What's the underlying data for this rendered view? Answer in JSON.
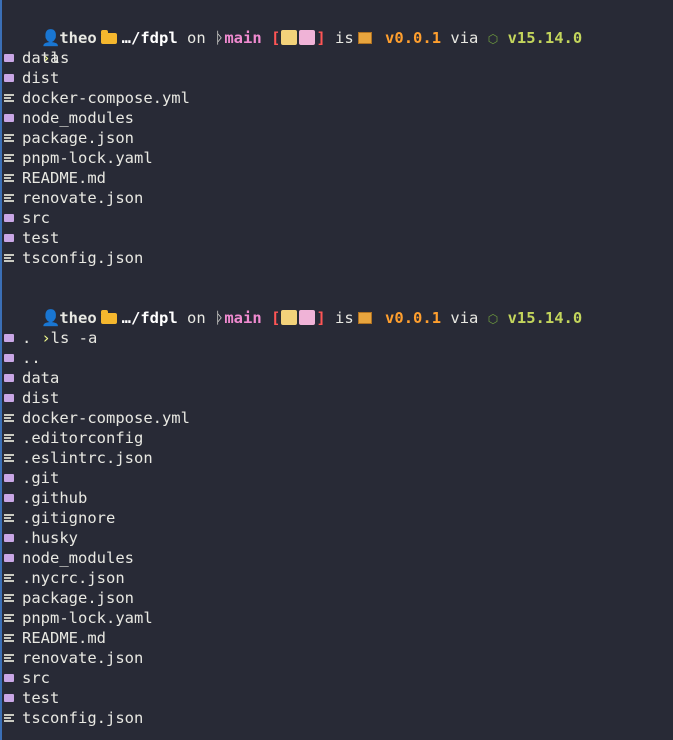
{
  "colors": {
    "background": "#282a36",
    "text": "#e8e8e2",
    "branch": "#f08ad0",
    "package_version": "#ff9f2e",
    "node_version": "#c3d55c",
    "prompt_arrow": "#f1fa8c",
    "dir_icon": "#c9a6e6"
  },
  "prompt": {
    "user": "theo",
    "path": "…/fdpl",
    "on": "on",
    "branch": "main",
    "status_open": "[",
    "status_close": "]",
    "is": "is",
    "package_version": "v0.0.1",
    "via": "via",
    "node_version": "v15.14.0",
    "arrow": "›"
  },
  "blocks": [
    {
      "command": "ls",
      "entries": [
        {
          "name": "data",
          "type": "dir"
        },
        {
          "name": "dist",
          "type": "dir"
        },
        {
          "name": "docker-compose.yml",
          "type": "file"
        },
        {
          "name": "node_modules",
          "type": "dir"
        },
        {
          "name": "package.json",
          "type": "file"
        },
        {
          "name": "pnpm-lock.yaml",
          "type": "file"
        },
        {
          "name": "README.md",
          "type": "file"
        },
        {
          "name": "renovate.json",
          "type": "file"
        },
        {
          "name": "src",
          "type": "dir"
        },
        {
          "name": "test",
          "type": "dir"
        },
        {
          "name": "tsconfig.json",
          "type": "file"
        }
      ]
    },
    {
      "command": "ls -a",
      "entries": [
        {
          "name": ".",
          "type": "dir"
        },
        {
          "name": "..",
          "type": "dir"
        },
        {
          "name": "data",
          "type": "dir"
        },
        {
          "name": "dist",
          "type": "dir"
        },
        {
          "name": "docker-compose.yml",
          "type": "file"
        },
        {
          "name": ".editorconfig",
          "type": "file"
        },
        {
          "name": ".eslintrc.json",
          "type": "file"
        },
        {
          "name": ".git",
          "type": "dir"
        },
        {
          "name": ".github",
          "type": "dir"
        },
        {
          "name": ".gitignore",
          "type": "file"
        },
        {
          "name": ".husky",
          "type": "dir"
        },
        {
          "name": "node_modules",
          "type": "dir"
        },
        {
          "name": ".nycrc.json",
          "type": "file"
        },
        {
          "name": "package.json",
          "type": "file"
        },
        {
          "name": "pnpm-lock.yaml",
          "type": "file"
        },
        {
          "name": "README.md",
          "type": "file"
        },
        {
          "name": "renovate.json",
          "type": "file"
        },
        {
          "name": "src",
          "type": "dir"
        },
        {
          "name": "test",
          "type": "dir"
        },
        {
          "name": "tsconfig.json",
          "type": "file"
        }
      ]
    }
  ]
}
